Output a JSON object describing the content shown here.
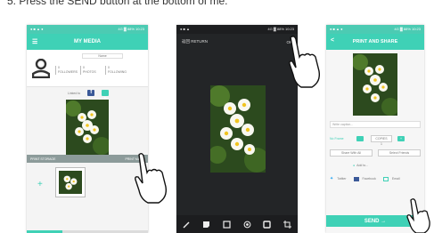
{
  "instruction": "5. Press the SEND button at the bottom of me.",
  "icons": {
    "menu": "menu-icon",
    "profile": "person-icon",
    "facebook": "facebook-icon",
    "video": "video-icon",
    "back": "back-arrow-icon",
    "hand": "pointing-hand-icon"
  },
  "colors": {
    "accent": "#3fd1b6",
    "dark_bg": "#232527",
    "button_gray": "#8c9b9a"
  },
  "screen1": {
    "status_left": "● ■ ▲ ●",
    "status_right": "4G ▓ 88% 10:23",
    "title": "MY MEDIA",
    "profile_name": "Name",
    "stats": [
      {
        "num": "0",
        "label": "FOLLOWERS"
      },
      {
        "num": "0",
        "label": "PHOTOS"
      },
      {
        "num": "0",
        "label": "FOLLOWING"
      }
    ],
    "link_label": "Linked to",
    "btn_left": "PRINT STORAGE",
    "btn_right": "PRINT MANY",
    "plus": "+"
  },
  "screen2": {
    "status_left": "● ■ ▲",
    "status_right": "4G ▓ 88% 10:23",
    "title": "返回  RETURN",
    "ok": "OK"
  },
  "screen3": {
    "status_left": "● ■ ▲ ●",
    "status_right": "4G ▓ 88% 10:23",
    "title": "PRINT AND SHARE",
    "back": "<",
    "caption_placeholder": "Write caption...",
    "option_label": "No Frame",
    "copies": "COPIES 1",
    "share_left": "Share With All",
    "share_right": "Select Friends",
    "location": "Add to...",
    "social": [
      "Twitter",
      "Facebook",
      "Email"
    ],
    "send": "SEND →"
  }
}
